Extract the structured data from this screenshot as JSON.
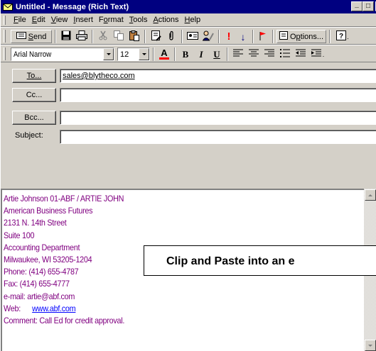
{
  "window": {
    "title": "Untitled - Message (Rich Text)",
    "minimize_glyph": "_",
    "maximize_glyph": "□",
    "close_glyph": "×"
  },
  "menu": [
    {
      "label": "File",
      "accel": "F",
      "rest": "ile"
    },
    {
      "label": "Edit",
      "accel": "E",
      "rest": "dit"
    },
    {
      "label": "View",
      "accel": "V",
      "rest": "iew"
    },
    {
      "label": "Insert",
      "accel": "I",
      "rest": "nsert"
    },
    {
      "label": "Format",
      "pre": "F",
      "accel": "o",
      "rest": "rmat"
    },
    {
      "label": "Tools",
      "accel": "T",
      "rest": "ools"
    },
    {
      "label": "Actions",
      "accel": "A",
      "rest": "ctions"
    },
    {
      "label": "Help",
      "accel": "H",
      "rest": "elp"
    }
  ],
  "toolbar": {
    "send_accel": "S",
    "send_rest": "end",
    "options_pre": "O",
    "options_accel": "p",
    "options_rest": "tions...",
    "font_name": "Arial Narrow",
    "font_size": "12",
    "importance_high_glyph": "!",
    "importance_low_glyph": "↓",
    "bold": "B",
    "italic": "I",
    "underline": "U",
    "font_color_glyph": "A"
  },
  "fields": {
    "to_label": "To...",
    "cc_label": "Cc...",
    "bcc_label": "Bcc...",
    "subject_label": "Subject:",
    "to_value": "sales@blytheco.com",
    "cc_value": "",
    "bcc_value": "",
    "subject_value": ""
  },
  "body": {
    "lines": [
      "Artie Johnson  01-ABF / ARTIE JOHN",
      "American Business Futures",
      "2131 N. 14th Street",
      "Suite 100",
      "Accounting Department",
      "Milwaukee, WI 53205-1204",
      "Phone:   (414) 655-4787",
      "Fax:   (414) 655-4777",
      "e-mail:  artie@abf.com"
    ],
    "web_label": "Web:",
    "web_link": "www.abf.com",
    "comment": "Comment: Call Ed for credit approval."
  },
  "callout": {
    "text": "Clip and Paste into an e"
  },
  "colors": {
    "titlebar": "#000080",
    "chrome": "#d4d0c8",
    "body_text": "#800080",
    "link": "#0000ff"
  }
}
